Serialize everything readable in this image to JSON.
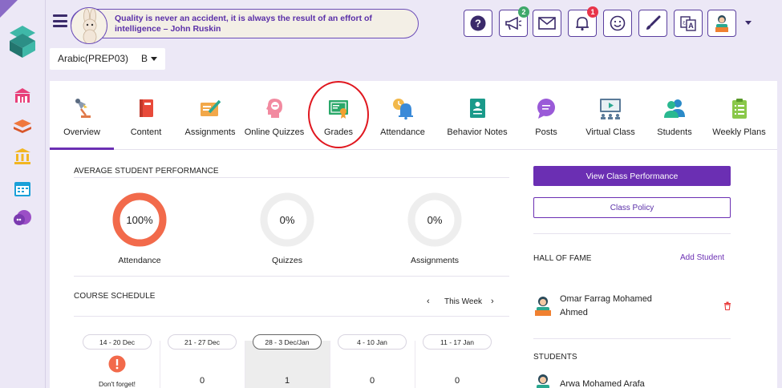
{
  "header": {
    "quote": "Quality is never an accident, it is always the result of an effort of intelligence – John Ruskin",
    "toolbar": [
      {
        "name": "help-icon",
        "badge": ""
      },
      {
        "name": "announcement-icon",
        "badge": "2"
      },
      {
        "name": "mail-icon",
        "badge": ""
      },
      {
        "name": "bell-icon",
        "badge": "1"
      },
      {
        "name": "smiley-icon",
        "badge": ""
      },
      {
        "name": "brush-icon",
        "badge": ""
      },
      {
        "name": "translate-icon",
        "badge": ""
      },
      {
        "name": "profile-avatar",
        "badge": ""
      }
    ]
  },
  "course": {
    "name": "Arabic(PREP03)",
    "section": "B"
  },
  "tabs": [
    "Overview",
    "Content",
    "Assignments",
    "Online Quizzes",
    "Grades",
    "Attendance",
    "Behavior Notes",
    "Posts",
    "Virtual Class",
    "Students",
    "Weekly Plans"
  ],
  "performance": {
    "title": "AVERAGE STUDENT PERFORMANCE",
    "items": [
      {
        "label": "Attendance",
        "value": "100%",
        "fraction": 1.0
      },
      {
        "label": "Quizzes",
        "value": "0%",
        "fraction": 0
      },
      {
        "label": "Assignments",
        "value": "0%",
        "fraction": 0
      }
    ]
  },
  "right": {
    "view_perf": "View Class Performance",
    "policy": "Class Policy",
    "hall_title": "HALL OF FAME",
    "add_student": "Add Student",
    "hall_person": "Omar Farrag Mohamed Ahmed",
    "students_title": "STUDENTS",
    "student_1": "Arwa Mohamed Arafa"
  },
  "schedule": {
    "title": "COURSE SCHEDULE",
    "week_label": "This Week",
    "weeks": [
      {
        "label": "14 - 20 Dec",
        "count": "",
        "note": "Don't forget!"
      },
      {
        "label": "21 - 27 Dec",
        "count": "0"
      },
      {
        "label": "28 - 3 Dec/Jan",
        "count": "1"
      },
      {
        "label": "4 - 10 Jan",
        "count": "0"
      },
      {
        "label": "11 - 17 Jan",
        "count": "0"
      }
    ]
  },
  "colors": {
    "accent": "#6b2fb3",
    "ring": "#f26a4b",
    "highlight": "#e01820"
  }
}
